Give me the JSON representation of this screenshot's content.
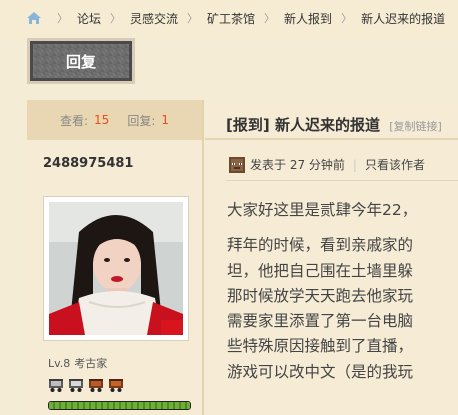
{
  "breadcrumb": {
    "items": [
      "论坛",
      "灵感交流",
      "矿工茶馆",
      "新人报到",
      "新人迟来的报道"
    ]
  },
  "reply_button": {
    "label": "回复"
  },
  "stats": {
    "views_label": "查看:",
    "views_value": "15",
    "replies_label": "回复:",
    "replies_value": "1"
  },
  "author": {
    "username": "2488975481",
    "level": "Lv.8",
    "title": "考古家",
    "medals": [
      "minecart-icon",
      "minecart-icon",
      "minecart-icon",
      "minecart-icon"
    ],
    "exp_progress": 1.0
  },
  "thread": {
    "prefix": "[报到]",
    "title": "新人迟来的报道",
    "copy_link": "[复制链接]"
  },
  "meta": {
    "posted": "发表于 27 分钟前",
    "only_author": "只看该作者"
  },
  "post": {
    "lines": [
      "大家好这里是贰肆今年22，",
      "拜年的时候，看到亲戚家的",
      "坦，他把自己围在土墙里躲",
      "那时候放学天天跑去他家玩",
      "需要家里添置了第一台电脑",
      "些特殊原因接触到了直播，",
      "游戏可以改中文（是的我玩"
    ]
  },
  "colors": {
    "accent_number": "#e94e1b",
    "page_bg": "#f5ecd6",
    "stats_bg": "#e8d7b2"
  }
}
